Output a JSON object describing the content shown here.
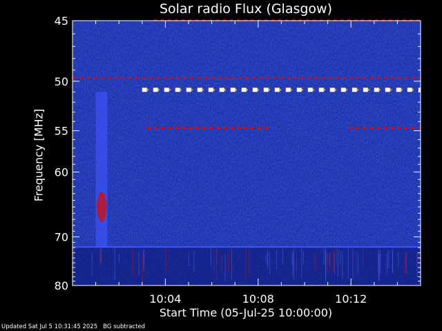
{
  "chart_data": {
    "type": "heatmap",
    "title": "Solar radio Flux (Glasgow)",
    "ylabel": "Frequency [MHz]",
    "xlabel": "Start Time (05-Jul-25 10:00:00)",
    "x_unit": "minutes after 10:00:00",
    "xlim": [
      0,
      15
    ],
    "ylim": [
      45,
      80
    ],
    "y_scale": "reciprocal",
    "yticks": [
      45,
      50,
      55,
      60,
      70,
      80
    ],
    "xticks": [
      {
        "minute": 4,
        "label": "10:04"
      },
      {
        "minute": 8,
        "label": "10:08"
      },
      {
        "minute": 12,
        "label": "10:12"
      }
    ],
    "colors": {
      "background": "#1a2fb0",
      "low": "#0a1470",
      "mid": "#cc1010",
      "high": "#ffffff",
      "warm": "#ffcc33"
    },
    "bands": [
      {
        "freq_mhz": 45.0,
        "t_range": [
          3.5,
          15
        ],
        "intensity": "medium"
      },
      {
        "freq_mhz": 49.7,
        "t_range": [
          0,
          15
        ],
        "intensity": "medium"
      },
      {
        "freq_mhz": 50.8,
        "t_range": [
          3.0,
          15
        ],
        "intensity": "high"
      },
      {
        "freq_mhz": 54.7,
        "t_range": [
          3.2,
          8.5
        ],
        "intensity": "medium"
      },
      {
        "freq_mhz": 54.7,
        "t_range": [
          11.9,
          15
        ],
        "intensity": "medium"
      }
    ],
    "bursts": [
      {
        "t_range": [
          1.0,
          1.5
        ],
        "freq_range": [
          51,
          72
        ],
        "intensity": "medium",
        "peak_freq_mhz": 65
      }
    ],
    "interference": {
      "t_range": [
        0,
        15
      ],
      "freq_range": [
        72,
        80
      ],
      "intensity": "low"
    }
  },
  "footer": {
    "updated": "Updated Sat Jul  5 10:31:45 2025",
    "note": "BG subtracted"
  }
}
